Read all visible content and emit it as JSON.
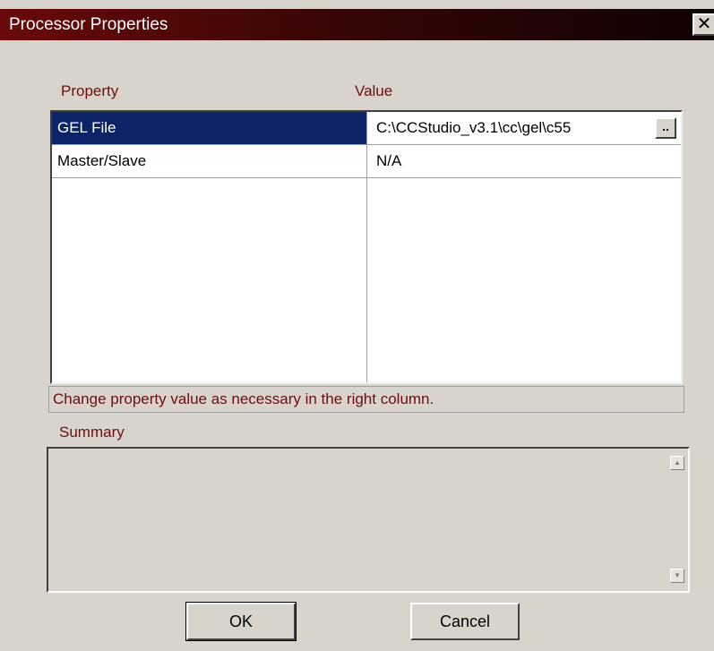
{
  "window": {
    "title": "Processor Properties",
    "close_glyph": "✕"
  },
  "table": {
    "headers": [
      "Property",
      "Value"
    ],
    "rows": [
      {
        "property": "GEL File",
        "value": "C:\\CCStudio_v3.1\\cc\\gel\\c55",
        "selected": true,
        "browse_label": ".."
      },
      {
        "property": "Master/Slave",
        "value": "N/A",
        "selected": false
      }
    ]
  },
  "hint": "Change property value as necessary in the right column.",
  "summary": {
    "label": "Summary",
    "text": ""
  },
  "buttons": {
    "ok": "OK",
    "cancel": "Cancel"
  },
  "colors": {
    "title_gradient_start": "#6a0a0a",
    "title_gradient_end": "#0e0202",
    "selection": "#0b2468",
    "label_text": "#6a1010",
    "dialog_bg": "#d8d4cc"
  }
}
